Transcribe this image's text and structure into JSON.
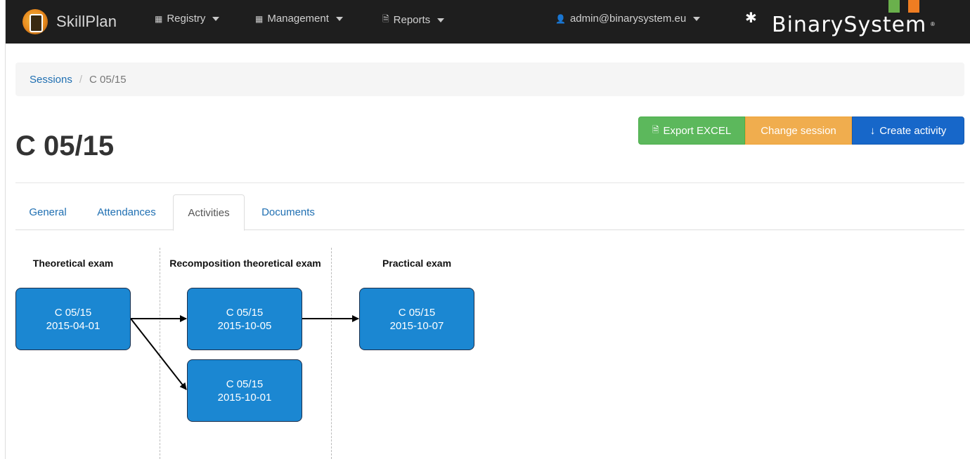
{
  "navbar": {
    "brand": "SkillPlan",
    "menus": [
      {
        "label": "Registry",
        "icon": "calendar-icon"
      },
      {
        "label": "Management",
        "icon": "calendar-icon"
      },
      {
        "label": "Reports",
        "icon": "document-icon"
      }
    ],
    "user": "admin@binarysystem.eu",
    "company_logo_text": "BinarySystem",
    "company_logo_mark": "®"
  },
  "breadcrumb": {
    "parent": "Sessions",
    "separator": "/",
    "current": "C 05/15"
  },
  "page": {
    "title": "C 05/15"
  },
  "actions": {
    "export": "Export EXCEL",
    "change": "Change session",
    "create": "Create activity",
    "colors": {
      "export": "#5cb85c",
      "change": "#f0ad4e",
      "create": "#1767c9"
    }
  },
  "tabs": [
    {
      "label": "General",
      "active": false
    },
    {
      "label": "Attendances",
      "active": false
    },
    {
      "label": "Activities",
      "active": true
    },
    {
      "label": "Documents",
      "active": false
    }
  ],
  "flow": {
    "columns": [
      "Theoretical exam",
      "Recomposition theoretical exam",
      "Practical exam"
    ],
    "nodes": [
      {
        "code": "C 05/15",
        "date": "2015-04-01"
      },
      {
        "code": "C 05/15",
        "date": "2015-10-05"
      },
      {
        "code": "C 05/15",
        "date": "2015-10-01"
      },
      {
        "code": "C 05/15",
        "date": "2015-10-07"
      }
    ],
    "node_color": "#1b87d2"
  }
}
